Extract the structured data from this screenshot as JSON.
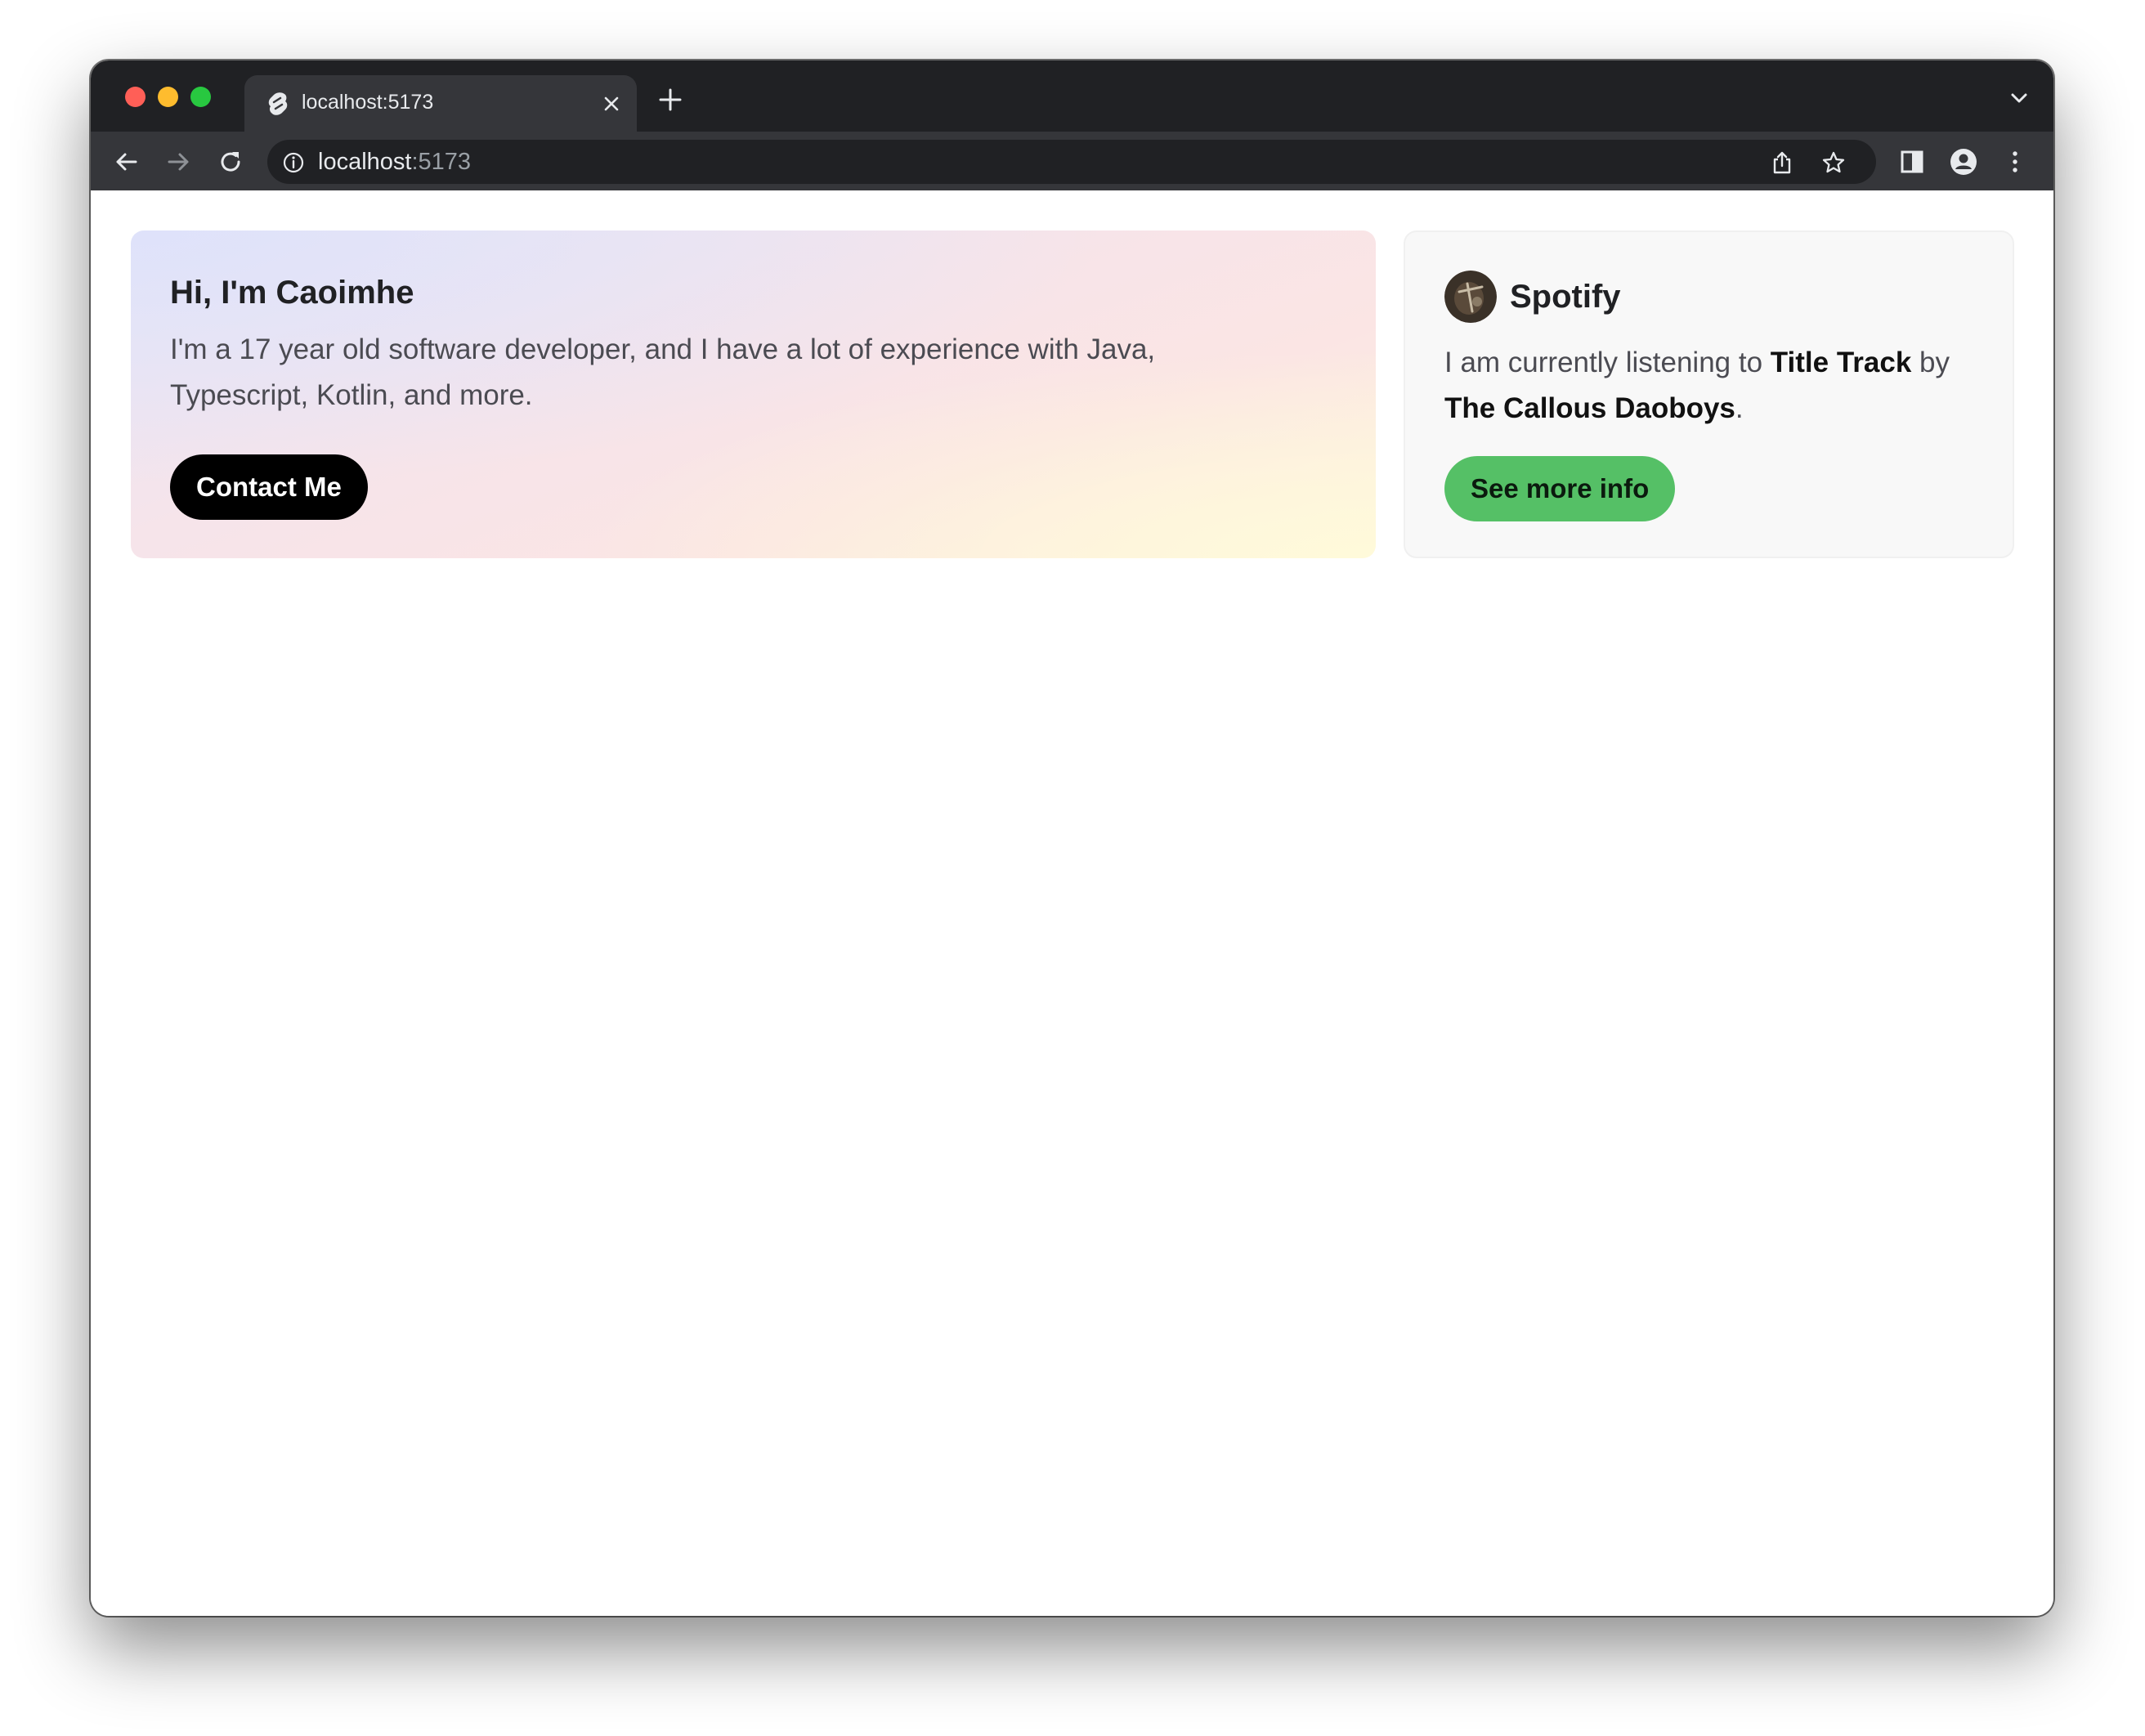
{
  "browser": {
    "tab_title": "localhost:5173",
    "url_host": "localhost",
    "url_port": ":5173"
  },
  "hero": {
    "title": "Hi, I'm Caoimhe",
    "description": "I'm a 17 year old software developer, and I have a lot of experience with Java, Typescript, Kotlin, and more.",
    "button_label": "Contact Me"
  },
  "spotify": {
    "title": "Spotify",
    "prefix": "I am currently listening to ",
    "track": "Title Track",
    "by": " by ",
    "artist": "The Callous Daoboys",
    "suffix": ".",
    "button_label": "See more info",
    "accent_color": "#55c066"
  },
  "icons": [
    "svelte-favicon-icon",
    "close-icon",
    "plus-icon",
    "chevron-down-icon",
    "back-arrow-icon",
    "forward-arrow-icon",
    "reload-icon",
    "info-icon",
    "share-icon",
    "star-icon",
    "side-panel-icon",
    "profile-icon",
    "more-vertical-icon"
  ]
}
